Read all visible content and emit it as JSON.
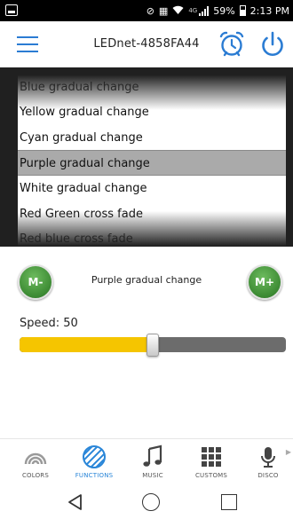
{
  "status_bar": {
    "net_type": "4G",
    "battery": "59%",
    "time": "2:13 PM"
  },
  "header": {
    "device_name": "LEDnet-4858FA44"
  },
  "picker": {
    "items": [
      "Blue gradual change",
      "Yellow gradual change",
      "Cyan gradual change",
      "Purple gradual change",
      "White gradual change",
      "Red Green cross fade",
      "Red blue cross fade"
    ],
    "selected_index": 3
  },
  "mode": {
    "minus_label": "M-",
    "plus_label": "M+",
    "current": "Purple gradual change"
  },
  "speed": {
    "label": "Speed: 50",
    "value": 50,
    "min": 0,
    "max": 100
  },
  "tabs": [
    {
      "label": "COLORS",
      "icon": "rainbow-icon",
      "active": false
    },
    {
      "label": "FUNCTIONS",
      "icon": "functions-icon",
      "active": true
    },
    {
      "label": "MUSIC",
      "icon": "music-note-icon",
      "active": false
    },
    {
      "label": "CUSTOMS",
      "icon": "grid-icon",
      "active": false
    },
    {
      "label": "DISCO",
      "icon": "microphone-icon",
      "active": false
    }
  ],
  "colors": {
    "accent": "#2a86d8",
    "slider_fill": "#f5c500",
    "slider_track": "#6c6c6c",
    "mode_button": "#3c8a33",
    "selected_row": "#aaaaaa"
  }
}
